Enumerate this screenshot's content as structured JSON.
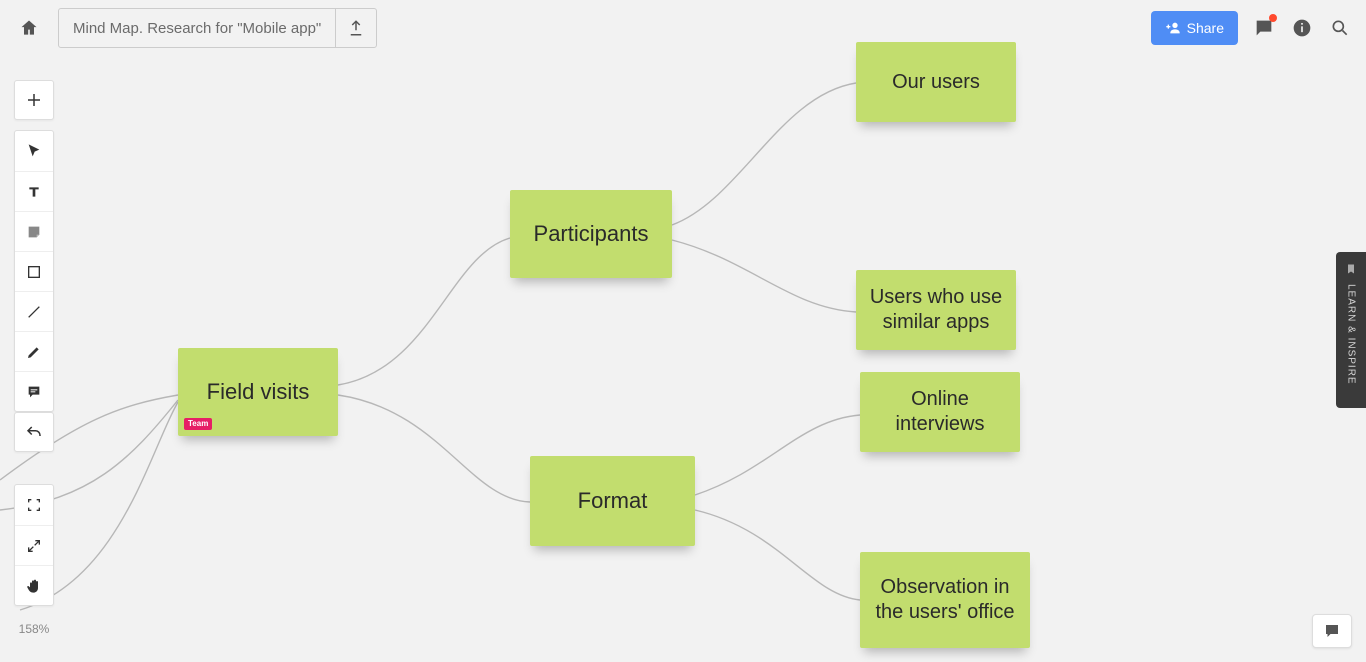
{
  "header": {
    "title": "Mind Map. Research for \"Mobile app\"",
    "share_label": "Share"
  },
  "toolbar": {
    "zoom": "158%"
  },
  "sidebar_tab": {
    "label": "LEARN & INSPIRE"
  },
  "nodes": {
    "root": "Field visits",
    "root_tag": "Team",
    "participants": "Participants",
    "format": "Format",
    "our_users": "Our users",
    "similar_apps": "Users who use similar apps",
    "online_interviews": "Online interviews",
    "observation": "Observation in the users' office"
  }
}
